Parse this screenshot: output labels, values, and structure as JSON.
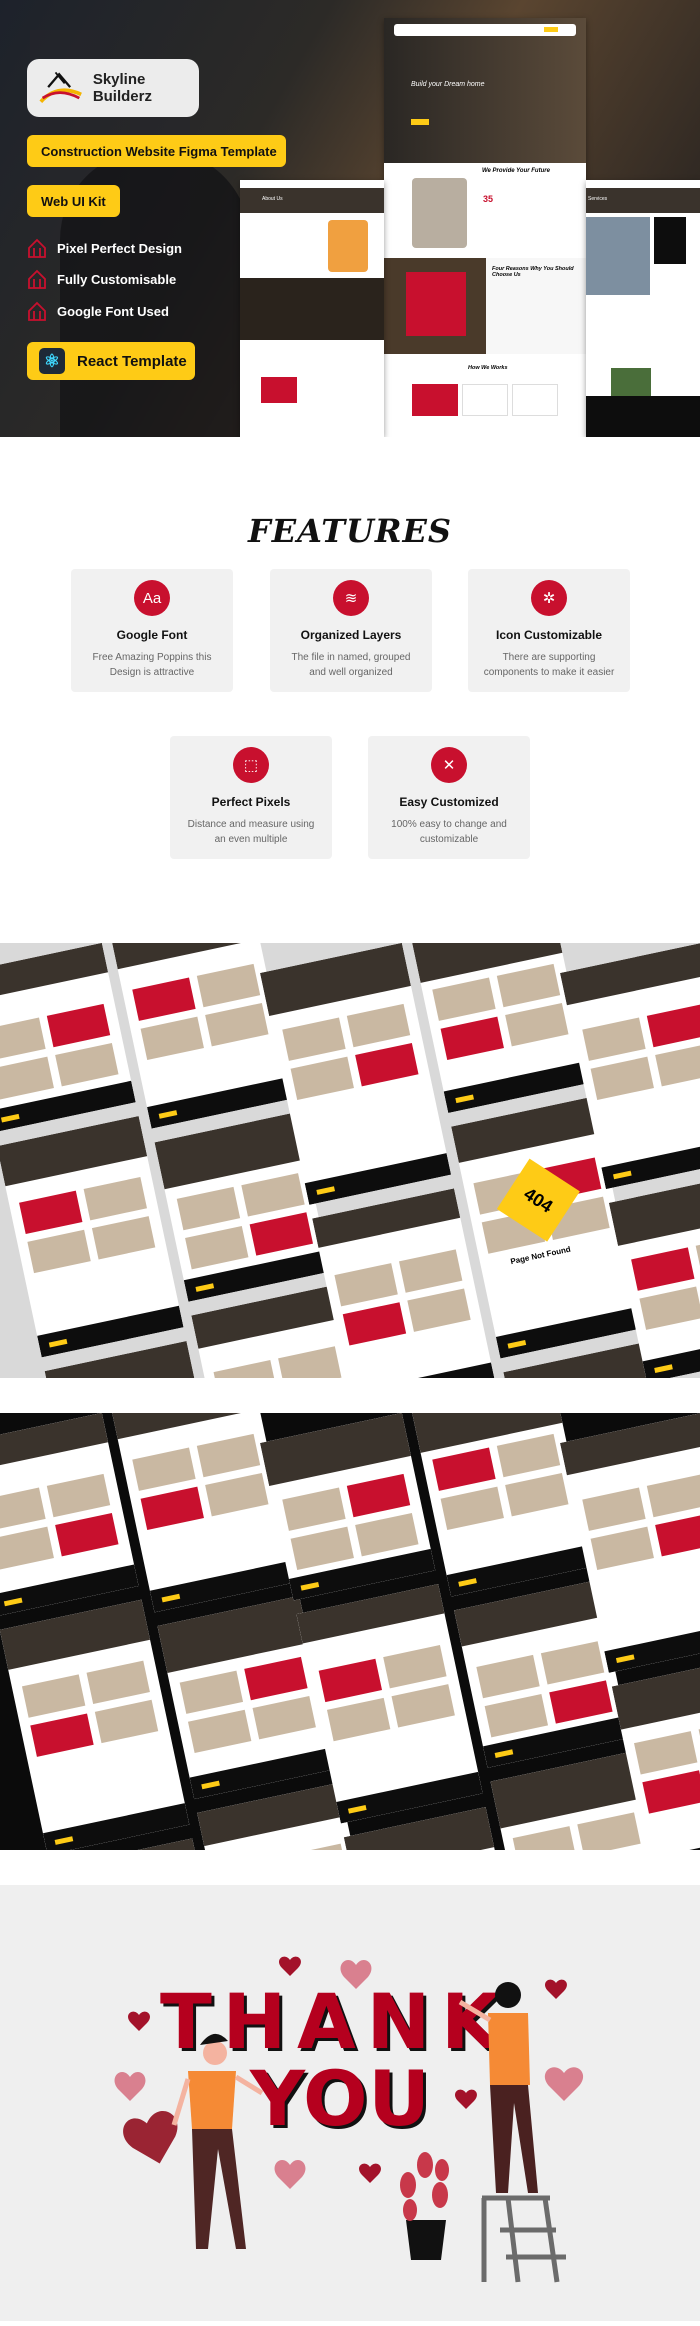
{
  "hero": {
    "brand": "Skyline Builderz",
    "headline": "Construction Website Figma Template",
    "kit": "Web UI Kit",
    "bullets": [
      "Pixel Perfect Design",
      "Fully Customisable",
      "Google Font Used"
    ],
    "react_button": "React Template",
    "accent": "#fecb16",
    "red": "#c8102e",
    "mockup_text": {
      "hero_title": "Build your Dream home",
      "about": "About Us",
      "provide": "We Provide Your Future",
      "years": "35",
      "reasons": "Four Reasons Why You Should Choose Us",
      "how": "How We Works",
      "services": "Services"
    }
  },
  "features": {
    "title": "FEATURES",
    "items": [
      {
        "icon": "font-icon",
        "glyph": "Aa",
        "title": "Google Font",
        "desc": "Free Amazing Poppins this Design is attractive"
      },
      {
        "icon": "layers-icon",
        "glyph": "≋",
        "title": "Organized Layers",
        "desc": "The file in named, grouped and well organized"
      },
      {
        "icon": "components-icon",
        "glyph": "✲",
        "title": "Icon Customizable",
        "desc": "There are supporting components to make it easier"
      },
      {
        "icon": "vector-icon",
        "glyph": "⬚",
        "title": "Perfect Pixels",
        "desc": "Distance and measure using an even multiple"
      },
      {
        "icon": "tools-icon",
        "glyph": "✕",
        "title": "Easy Customized",
        "desc": "100% easy to change and customizable"
      }
    ]
  },
  "collage": {
    "not_found_code": "404",
    "not_found_text": "Page Not Found"
  },
  "thanks": {
    "line1": "THANK",
    "line2": "YOU",
    "color": "#b5001e"
  }
}
